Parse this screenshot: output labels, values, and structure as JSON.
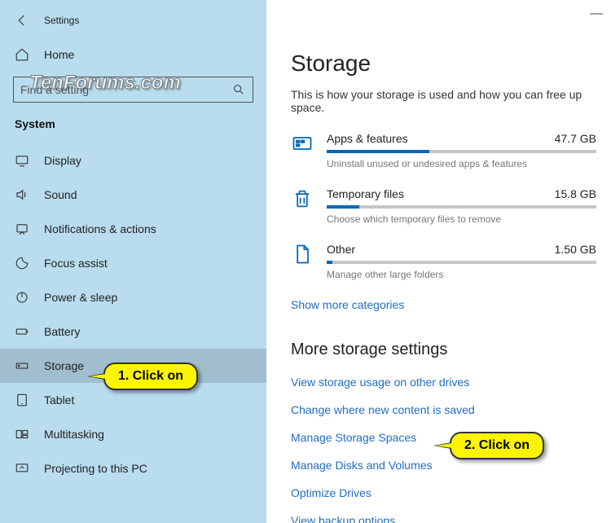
{
  "header": {
    "title": "Settings"
  },
  "sidebar": {
    "home_label": "Home",
    "search_placeholder": "Find a setting",
    "category": "System",
    "items": [
      {
        "label": "Display"
      },
      {
        "label": "Sound"
      },
      {
        "label": "Notifications & actions"
      },
      {
        "label": "Focus assist"
      },
      {
        "label": "Power & sleep"
      },
      {
        "label": "Battery"
      },
      {
        "label": "Storage"
      },
      {
        "label": "Tablet"
      },
      {
        "label": "Multitasking"
      },
      {
        "label": "Projecting to this PC"
      }
    ]
  },
  "main": {
    "title": "Storage",
    "subtitle": "This is how your storage is used and how you can free up space.",
    "items": [
      {
        "name": "Apps & features",
        "size": "47.7 GB",
        "fill": 38,
        "desc": "Uninstall unused or undesired apps & features"
      },
      {
        "name": "Temporary files",
        "size": "15.8 GB",
        "fill": 12,
        "desc": "Choose which temporary files to remove"
      },
      {
        "name": "Other",
        "size": "1.50 GB",
        "fill": 2,
        "desc": "Manage other large folders"
      }
    ],
    "show_more": "Show more categories",
    "more_title": "More storage settings",
    "links": [
      "View storage usage on other drives",
      "Change where new content is saved",
      "Manage Storage Spaces",
      "Manage Disks and Volumes",
      "Optimize Drives",
      "View backup options"
    ]
  },
  "annotations": {
    "watermark": "TenForums.com",
    "callout1": "1. Click on",
    "callout2": "2. Click on"
  }
}
